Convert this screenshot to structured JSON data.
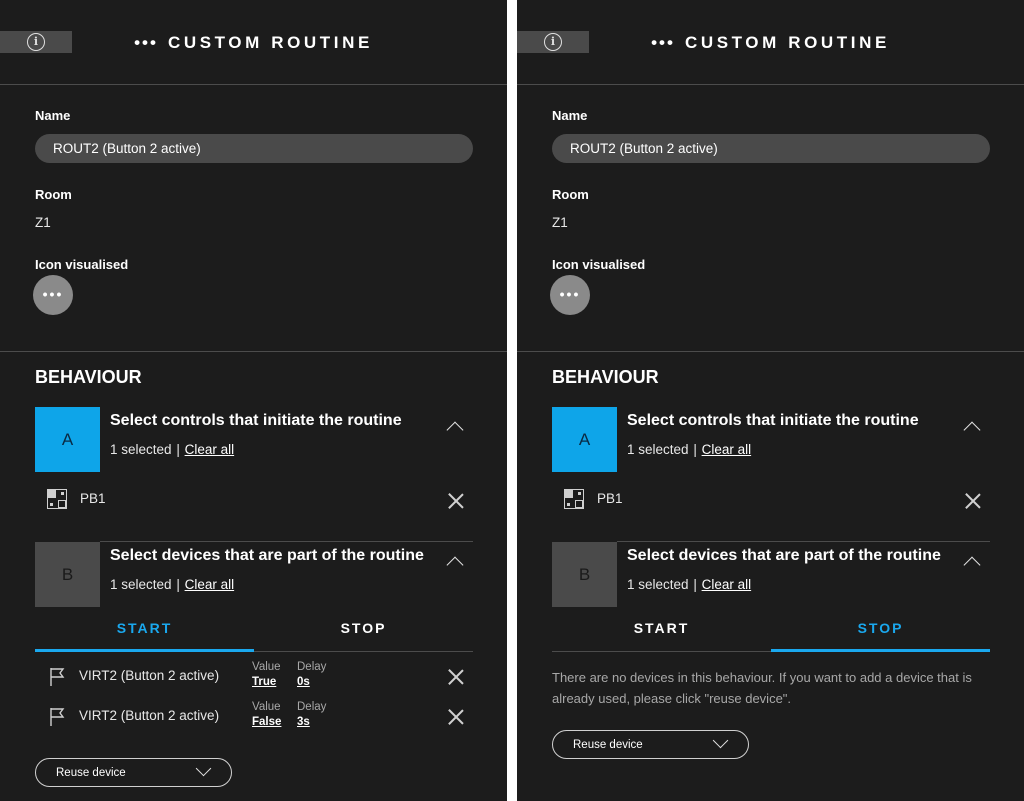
{
  "left": {
    "header": {
      "dots": "•••",
      "title": "CUSTOM ROUTINE",
      "info_icon": "info-icon"
    },
    "form": {
      "name_label": "Name",
      "name_value": "ROUT2 (Button 2 active)",
      "room_label": "Room",
      "room_value": "Z1",
      "icon_label": "Icon visualised",
      "icon_glyph": "•••"
    },
    "behaviour": {
      "title": "BEHAVIOUR",
      "section_a": {
        "badge": "A",
        "title": "Select controls that initiate the routine",
        "selected": "1 selected",
        "sep": "|",
        "clear": "Clear all",
        "items": [
          {
            "label": "PB1",
            "icon": "pushbutton-icon"
          }
        ]
      },
      "section_b": {
        "badge": "B",
        "title": "Select devices that are part of the routine",
        "selected": "1 selected",
        "sep": "|",
        "clear": "Clear all"
      },
      "tabs": [
        {
          "label": "START",
          "active": true
        },
        {
          "label": "STOP",
          "active": false
        }
      ],
      "devices": [
        {
          "name": "VIRT2 (Button 2 active)",
          "value_label": "Value",
          "value": "True",
          "delay_label": "Delay",
          "delay": "0s"
        },
        {
          "name": "VIRT2 (Button 2 active)",
          "value_label": "Value",
          "value": "False",
          "delay_label": "Delay",
          "delay": "3s"
        }
      ],
      "reuse_label": "Reuse device"
    }
  },
  "right": {
    "header": {
      "dots": "•••",
      "title": "CUSTOM ROUTINE",
      "info_icon": "info-icon"
    },
    "form": {
      "name_label": "Name",
      "name_value": "ROUT2 (Button 2 active)",
      "room_label": "Room",
      "room_value": "Z1",
      "icon_label": "Icon visualised",
      "icon_glyph": "•••"
    },
    "behaviour": {
      "title": "BEHAVIOUR",
      "section_a": {
        "badge": "A",
        "title": "Select controls that initiate the routine",
        "selected": "1 selected",
        "sep": "|",
        "clear": "Clear all",
        "items": [
          {
            "label": "PB1",
            "icon": "pushbutton-icon"
          }
        ]
      },
      "section_b": {
        "badge": "B",
        "title": "Select devices that are part of the routine",
        "selected": "1 selected",
        "sep": "|",
        "clear": "Clear all"
      },
      "tabs": [
        {
          "label": "START",
          "active": false
        },
        {
          "label": "STOP",
          "active": true
        }
      ],
      "empty_message": "There are no devices in this behaviour. If you want to add a device that is already used, please click \"reuse device\".",
      "reuse_label": "Reuse device"
    }
  },
  "colors": {
    "background": "#1c1c1c",
    "accent": "#1aa8ee",
    "tile_a": "#0ea5e9",
    "tile_b": "#4a4a4a"
  }
}
